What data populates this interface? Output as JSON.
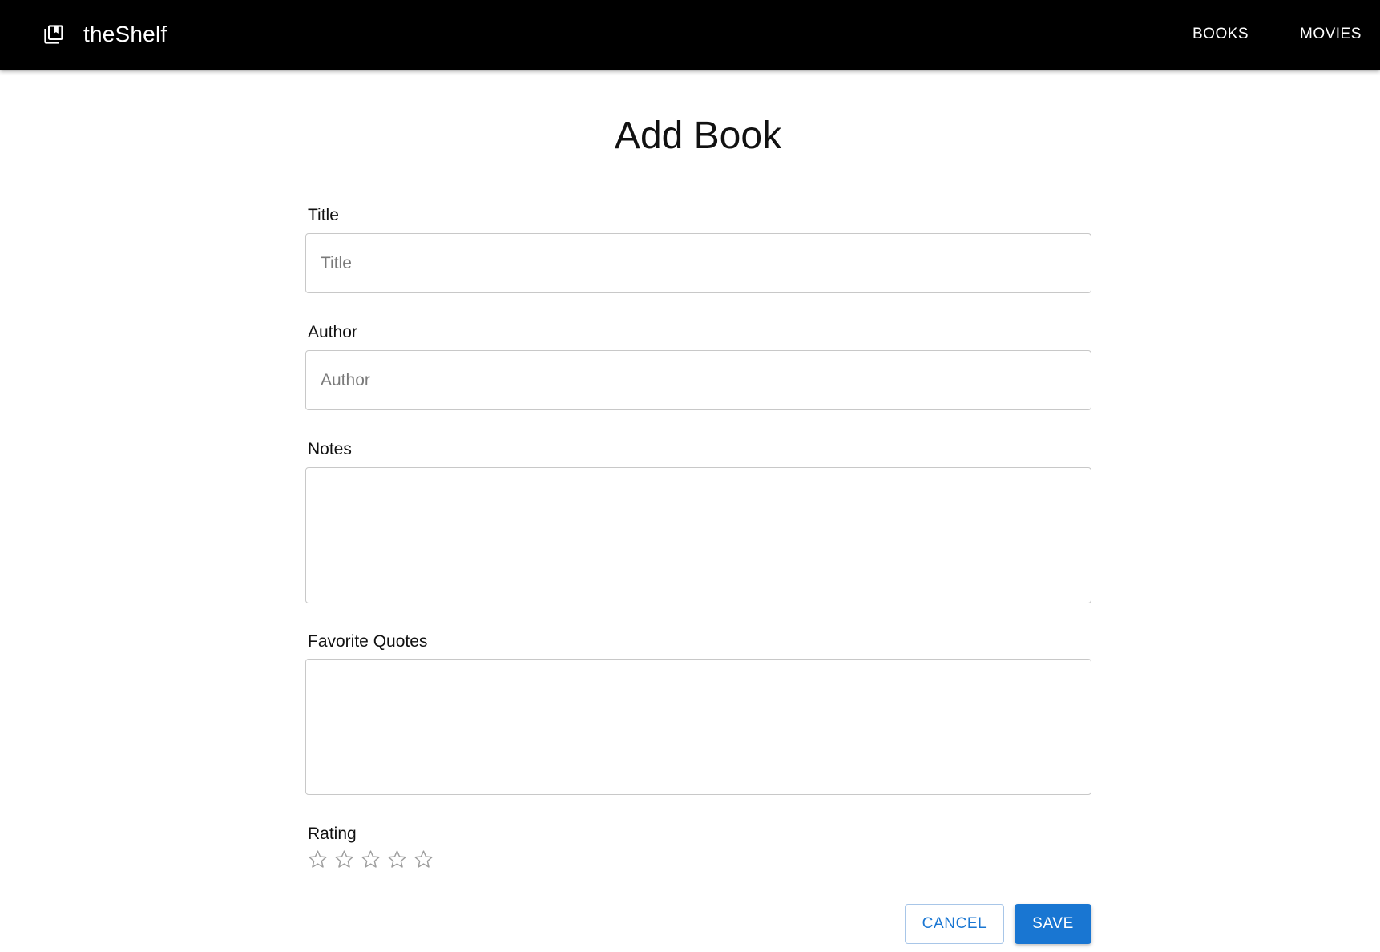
{
  "app": {
    "name": "theShelf",
    "icon": "library-books-icon"
  },
  "nav": {
    "items": [
      {
        "label": "BOOKS"
      },
      {
        "label": "MOVIES"
      }
    ]
  },
  "page": {
    "title": "Add Book"
  },
  "form": {
    "title": {
      "label": "Title",
      "placeholder": "Title",
      "value": ""
    },
    "author": {
      "label": "Author",
      "placeholder": "Author",
      "value": ""
    },
    "notes": {
      "label": "Notes",
      "value": ""
    },
    "quotes": {
      "label": "Favorite Quotes",
      "value": ""
    },
    "rating": {
      "label": "Rating",
      "value": 0,
      "max": 5,
      "icon": "star-outline-icon"
    },
    "actions": {
      "cancel_label": "CANCEL",
      "save_label": "SAVE"
    }
  },
  "colors": {
    "appbar": "#000000",
    "primary": "#1976d2",
    "star_outline": "#9e9e9e"
  }
}
